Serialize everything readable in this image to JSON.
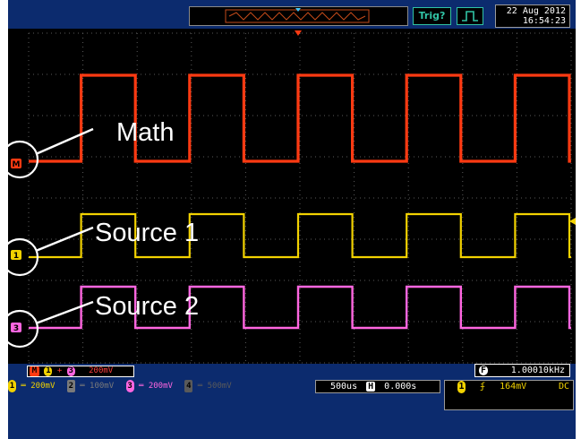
{
  "header": {
    "trigger_label": "Trig?",
    "date": "22 Aug 2012",
    "time": "16:54:23"
  },
  "annotations": {
    "math": "Math",
    "source1": "Source 1",
    "source2": "Source 2"
  },
  "channels": {
    "math": {
      "marker": "M",
      "color": "#ff3a12"
    },
    "ch1": {
      "marker": "1",
      "color": "#f2d200"
    },
    "ch2": {
      "marker": "2",
      "color": "#7a7a7a"
    },
    "ch3": {
      "marker": "3",
      "color": "#ff66e0"
    },
    "ch4": {
      "marker": "4",
      "color": "#5a5a5a"
    }
  },
  "status": {
    "math_expression": "M 1 + 3 200mV",
    "frequency_marker": "F",
    "frequency": "1.00010kHz",
    "ch1_scale": "200mV",
    "ch2_scale": "100mV",
    "ch3_scale": "200mV",
    "ch4_scale": "500mV",
    "timebase": "500us",
    "timebase_icon": "H",
    "delay": "0.000s",
    "trigger_level": "164mV",
    "coupling": "DC"
  },
  "waveforms": {
    "period_us": 1000,
    "duty_percent": 50,
    "cycles_shown": 5
  }
}
